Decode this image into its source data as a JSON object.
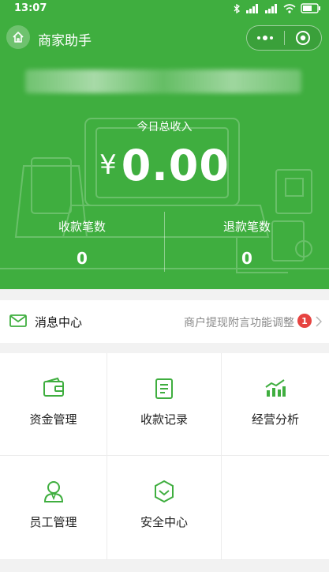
{
  "status_bar": {
    "time": "13:07"
  },
  "titlebar": {
    "title": "商家助手"
  },
  "hero": {
    "income_label": "今日总收入",
    "currency": "¥",
    "income_amount": "0.00",
    "stats": [
      {
        "label": "收款笔数",
        "value": "0"
      },
      {
        "label": "退款笔数",
        "value": "0"
      }
    ]
  },
  "message": {
    "title": "消息中心",
    "notice": "商户提现附言功能调整",
    "badge": "1"
  },
  "grid": [
    {
      "label": "资金管理",
      "icon": "wallet-icon"
    },
    {
      "label": "收款记录",
      "icon": "receipt-icon"
    },
    {
      "label": "经营分析",
      "icon": "bar-chart-icon"
    },
    {
      "label": "员工管理",
      "icon": "staff-icon"
    },
    {
      "label": "安全中心",
      "icon": "shield-icon"
    }
  ],
  "colors": {
    "brand_green": "#3fae3f",
    "badge_red": "#e64340"
  }
}
